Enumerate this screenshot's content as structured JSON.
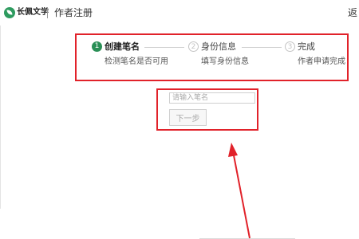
{
  "header": {
    "logo_text": "长佩文学",
    "page_title": "作者注册",
    "back_label": "返"
  },
  "steps": [
    {
      "number": "1",
      "title": "创建笔名",
      "description": "检测笔名是否可用",
      "state": "active"
    },
    {
      "number": "2",
      "title": "身份信息",
      "description": "填写身份信息",
      "state": "inactive"
    },
    {
      "number": "3",
      "title": "完成",
      "description": "作者申请完成",
      "state": "inactive"
    }
  ],
  "form": {
    "pen_name_value": "",
    "pen_name_placeholder": "请输入笔名",
    "next_label": "下一步"
  },
  "colors": {
    "accent_green": "#2a8f56",
    "annotation_red": "#e1222a"
  }
}
